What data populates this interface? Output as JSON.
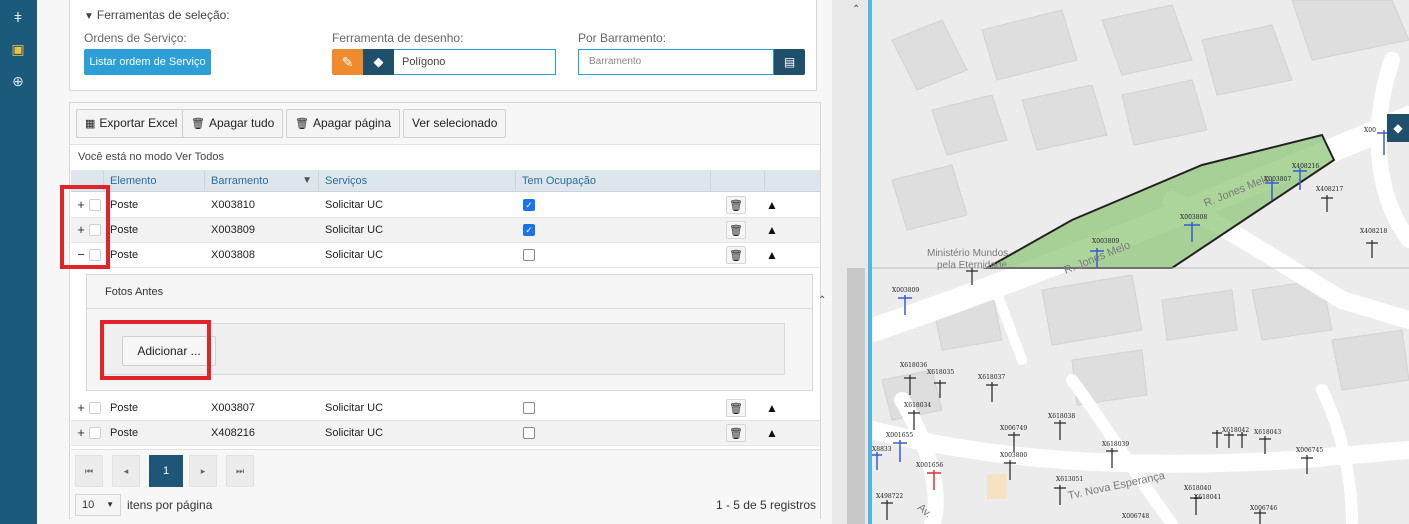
{
  "selection": {
    "title": "Ferramentas de seleção:",
    "orders_label": "Ordens de Serviço:",
    "orders_button": "Listar ordem de Serviço",
    "draw_label": "Ferramenta de desenho:",
    "draw_value": "Polígono",
    "bus_label": "Por Barramento:",
    "bus_placeholder": "Barramento"
  },
  "toolbar": {
    "export": "Exportar Excel",
    "delete_all": "Apagar tudo",
    "delete_page": "Apagar página",
    "view_selected": "Ver selecionado"
  },
  "mode_text": "Você está no modo Ver Todos",
  "columns": {
    "elemento": "Elemento",
    "barramento": "Barramento",
    "servicos": "Serviços",
    "ocupacao": "Tem Ocupação"
  },
  "rows": [
    {
      "expander": "+",
      "elemento": "Poste",
      "barramento": "X003810",
      "servicos": "Solicitar UC",
      "ocupacao": true
    },
    {
      "expander": "+",
      "elemento": "Poste",
      "barramento": "X003809",
      "servicos": "Solicitar UC",
      "ocupacao": true
    },
    {
      "expander": "−",
      "elemento": "Poste",
      "barramento": "X003808",
      "servicos": "Solicitar UC",
      "ocupacao": false
    },
    {
      "expander": "+",
      "elemento": "Poste",
      "barramento": "X003807",
      "servicos": "Solicitar UC",
      "ocupacao": false
    },
    {
      "expander": "+",
      "elemento": "Poste",
      "barramento": "X408216",
      "servicos": "Solicitar UC",
      "ocupacao": false
    }
  ],
  "detail": {
    "header": "Fotos Antes",
    "add_button": "Adicionar ..."
  },
  "pager": {
    "current_page": "1",
    "page_size": "10",
    "items_per_page": "itens por página",
    "records": "1 - 5 de 5 registros"
  },
  "map": {
    "streets": [
      "R. Jones Melo",
      "R. Jones Melo",
      "Tv. Nova Esperança",
      "Av."
    ],
    "poi": [
      "Ministério Mundos",
      "pela Eternidade"
    ],
    "pole_labels": [
      "X003809",
      "X003808",
      "X003807",
      "X408216",
      "X408217",
      "X408218",
      "X00",
      "X003809",
      "X618036",
      "X618035",
      "X618037",
      "X618034",
      "X001655",
      "X618038",
      "X006749",
      "X003800",
      "X618039",
      "X618042",
      "X618043",
      "X006745",
      "X001656",
      "X613051",
      "X618040",
      "X618041",
      "X498722",
      "X006746",
      "X006748",
      "X8833"
    ]
  },
  "colors": {
    "rail": "#1b5a7b",
    "accent_blue": "#2b9fd6",
    "accent_orange": "#ef8a2d",
    "dark_btn": "#1f4f6b",
    "highlight_red": "#e0242a",
    "polygon_fill": "#8fc77a"
  }
}
